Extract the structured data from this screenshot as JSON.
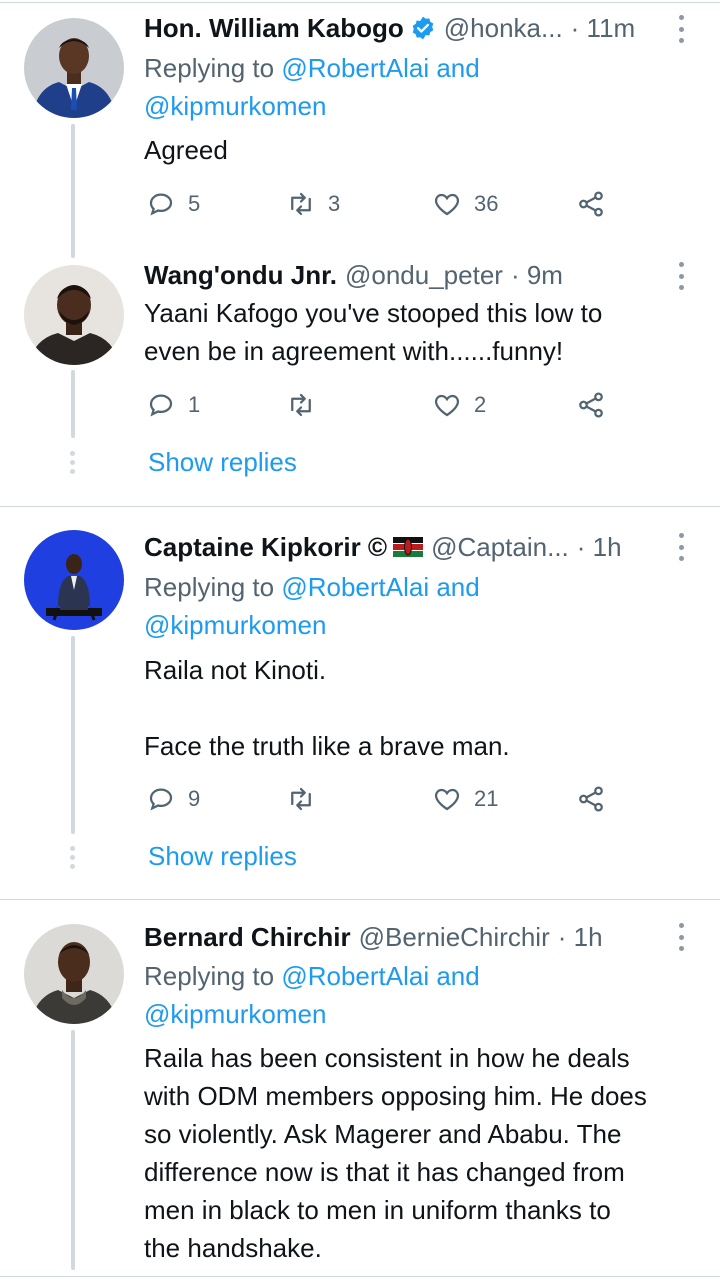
{
  "tweets": [
    {
      "name": "Hon. William Kabogo",
      "handle": "@honka...",
      "time": "· 11m",
      "reply_prefix": "Replying to",
      "reply_line1": "@RobertAlai and",
      "reply_line2": "@kipmurkomen",
      "text": "Agreed",
      "replies": "5",
      "retweets": "3",
      "likes": "36"
    },
    {
      "name": "Wang'ondu Jnr.",
      "handle": "@ondu_peter",
      "time": "· 9m",
      "text_lines": [
        "Yaani Kafogo you've stooped this low to",
        "even be in agreement with......funny!"
      ],
      "replies": "1",
      "likes": "2",
      "show_replies": "Show replies"
    },
    {
      "name": "Captaine Kipkorir ©",
      "handle": "@Captain...",
      "time": "· 1h",
      "reply_prefix": "Replying to",
      "reply_line1": "@RobertAlai and",
      "reply_line2": "@kipmurkomen",
      "text_line1": "Raila not Kinoti.",
      "text_line2": "Face the truth like a brave man.",
      "replies": "9",
      "likes": "21",
      "show_replies": "Show replies"
    },
    {
      "name": "Bernard Chirchir",
      "handle": "@BernieChirchir",
      "time": "· 1h",
      "reply_prefix": "Replying to",
      "reply_line1": "@RobertAlai and",
      "reply_line2": "@kipmurkomen",
      "text_lines": [
        "Raila has been consistent in how he deals",
        "with ODM members opposing him. He does",
        "so violently. Ask Magerer and Ababu. The",
        "difference now is that it has changed from",
        "men in black to men in uniform thanks to",
        "the handshake."
      ]
    }
  ],
  "icons": {
    "reply": "speech-bubble-icon",
    "retweet": "retweet-icon",
    "like": "heart-icon",
    "share": "share-icon",
    "verified": "verified-badge-icon",
    "flag": "kenya-flag-icon"
  },
  "colors": {
    "link": "#1d9bf0",
    "secondary_text": "#536471",
    "verified": "#1d9bf0"
  }
}
